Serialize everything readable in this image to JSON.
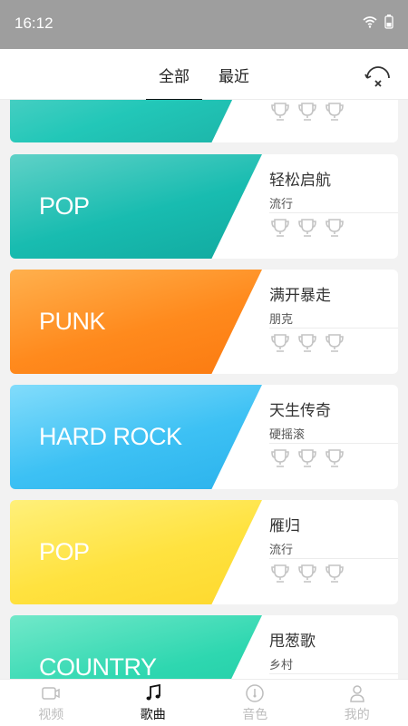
{
  "status_bar": {
    "time": "16:12",
    "icons": [
      "wifi-icon",
      "battery-icon"
    ]
  },
  "top_nav": {
    "tabs": [
      {
        "label": "全部",
        "active": true
      },
      {
        "label": "最近",
        "active": false
      }
    ],
    "action_icon": "sync-icon"
  },
  "cards": [
    {
      "genre": "",
      "title": "",
      "category": "",
      "colors": [
        "#22c7b8",
        "#6ad6cc"
      ]
    },
    {
      "genre": "POP",
      "title": "轻松启航",
      "category": "流行",
      "colors": [
        "#18bcb0",
        "#5fd1c7"
      ]
    },
    {
      "genre": "PUNK",
      "title": "满开暴走",
      "category": "朋克",
      "colors": [
        "#ff8a1d",
        "#ffb04d"
      ]
    },
    {
      "genre": "HARD ROCK",
      "title": "天生传奇",
      "category": "硬摇滚",
      "colors": [
        "#3dc1f4",
        "#82dcfb"
      ]
    },
    {
      "genre": "POP",
      "title": "雁归",
      "category": "流行",
      "colors": [
        "#ffe23f",
        "#fff07a"
      ]
    },
    {
      "genre": "COUNTRY",
      "title": "甩葱歌",
      "category": "乡村",
      "colors": [
        "#2ed7b0",
        "#71e8c9"
      ]
    }
  ],
  "bottom_nav": {
    "items": [
      {
        "label": "视频",
        "icon": "video-icon",
        "active": false
      },
      {
        "label": "歌曲",
        "icon": "music-note-icon",
        "active": true
      },
      {
        "label": "音色",
        "icon": "tone-icon",
        "active": false
      },
      {
        "label": "我的",
        "icon": "person-icon",
        "active": false
      }
    ]
  },
  "colors": {
    "status_bar": "#9e9e9e",
    "background": "#f2f2f2",
    "trophy_outline": "#c4c4c4"
  }
}
